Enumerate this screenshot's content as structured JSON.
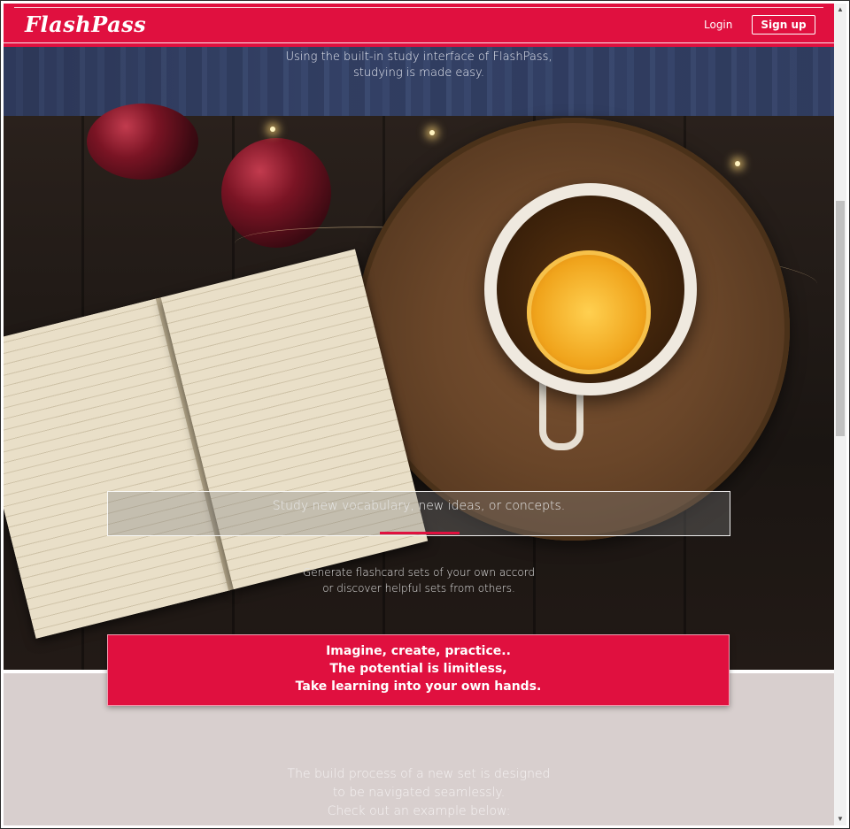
{
  "nav": {
    "brand": "FlashPass",
    "login_label": "Login",
    "signup_label": "Sign up"
  },
  "hero_top": {
    "line1": "Using the built-in study interface of FlashPass,",
    "line2": "studying is made easy."
  },
  "study": {
    "search_placeholder": "Study new vocabulary, new ideas, or concepts.",
    "sub_line1": "Generate flashcard sets of your own accord",
    "sub_line2": "or discover helpful sets from others."
  },
  "tagline": {
    "line1": "Imagine, create, practice..",
    "line2": "The potential is limitless,",
    "line3": "Take learning into your own hands."
  },
  "build": {
    "line1": "The build process of a new set is designed",
    "line2": "to be navigated seamlessly.",
    "line3": "Check out an example below:"
  },
  "colors": {
    "accent": "#e0103f",
    "lower_bg": "#d8cfce"
  },
  "icons": {
    "scroll_up": "scroll-up-arrow",
    "scroll_down": "scroll-down-arrow"
  }
}
